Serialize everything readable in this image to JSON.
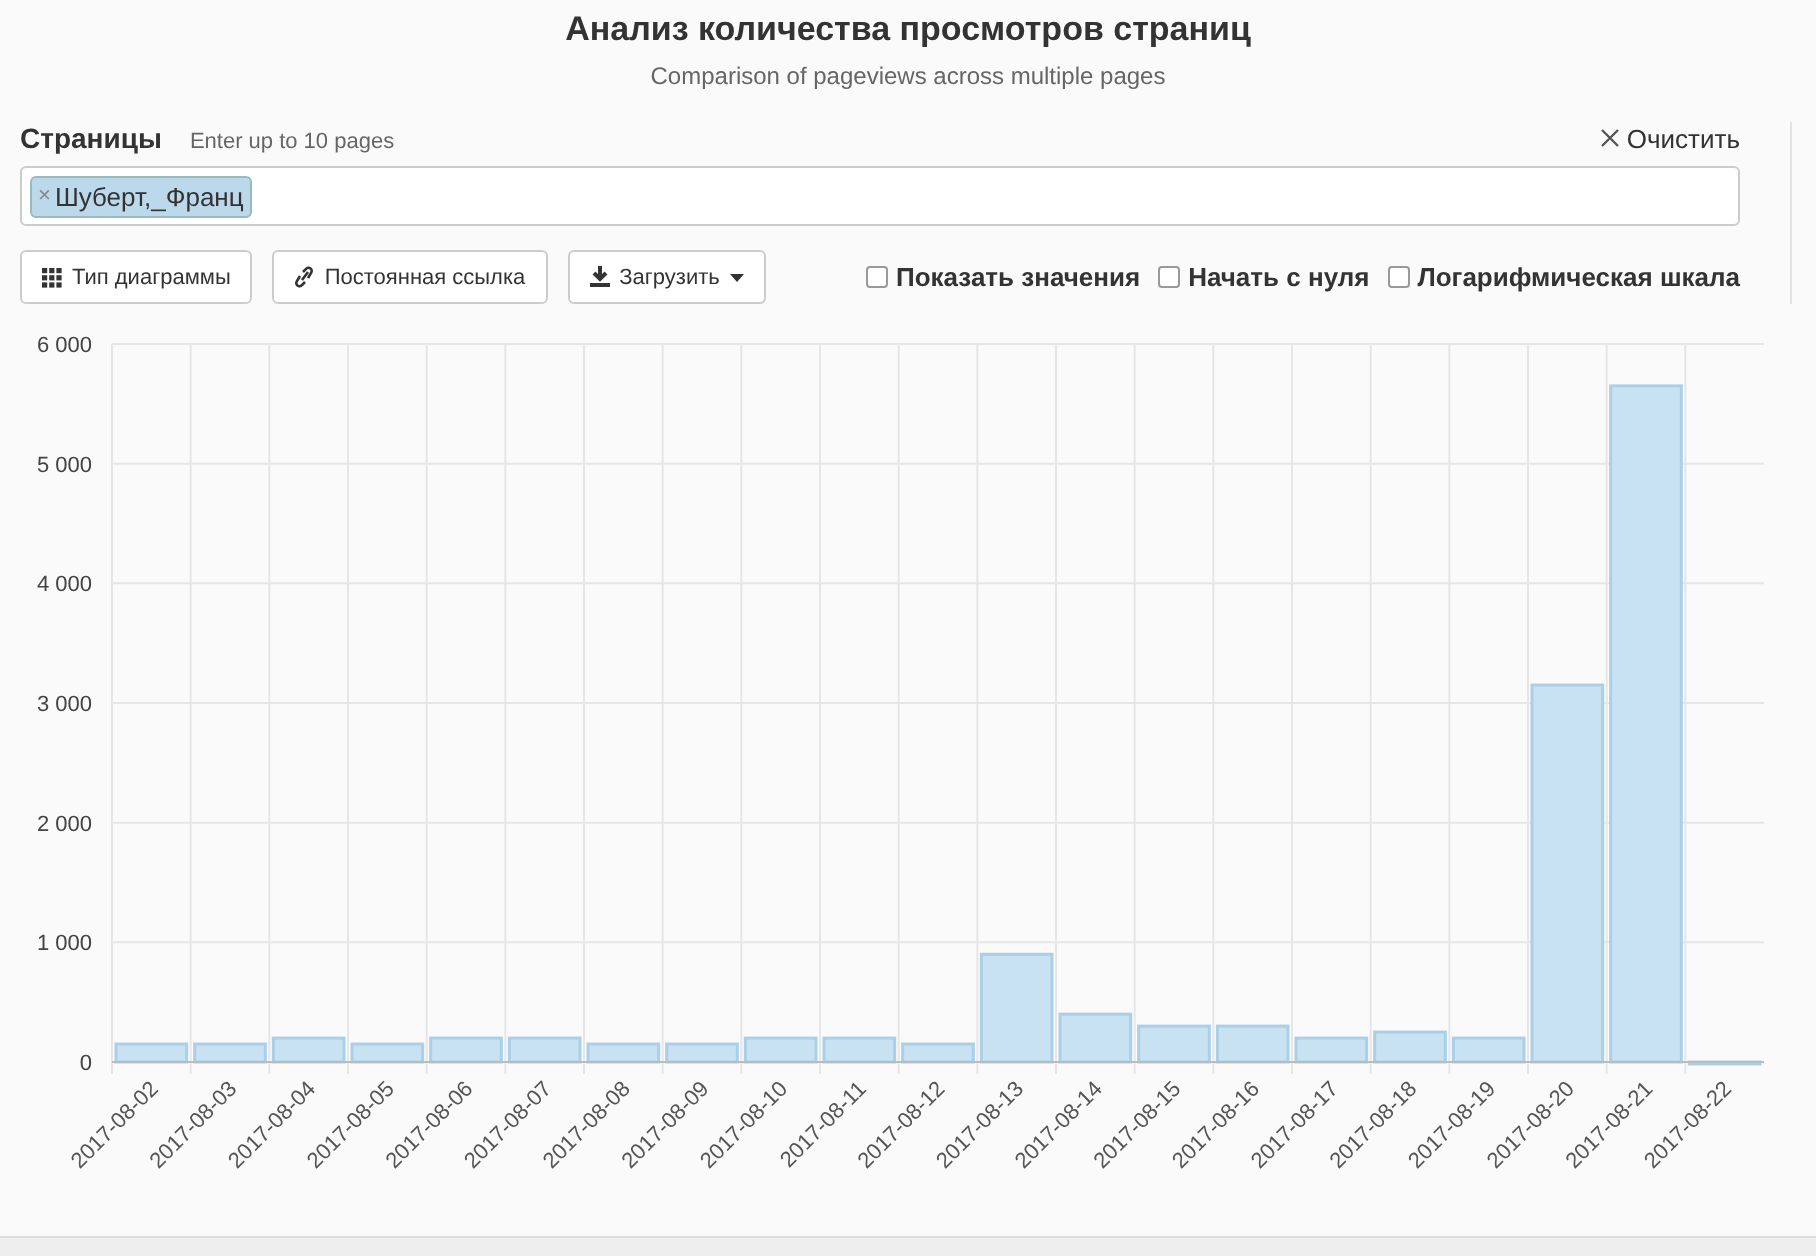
{
  "header": {
    "title": "Анализ количества просмотров страниц",
    "subtitle": "Comparison of pageviews across multiple pages"
  },
  "pages": {
    "label": "Страницы",
    "hint": "Enter up to 10 pages",
    "clear": "Очистить",
    "tags": [
      {
        "remove": "×",
        "text": "Шуберт,_Франц"
      }
    ]
  },
  "toolbar": {
    "buttons": [
      {
        "kind": "grid",
        "label": "Тип диаграммы"
      },
      {
        "kind": "link",
        "label": "Постоянная ссылка"
      },
      {
        "kind": "download",
        "label": "Загрузить"
      }
    ],
    "options": [
      {
        "label": "Показать значения",
        "checked": false
      },
      {
        "label": "Начать с нуля",
        "checked": false
      },
      {
        "label": "Логарифмическая шкала",
        "checked": false
      }
    ]
  },
  "chart_data": {
    "type": "bar",
    "categories": [
      "2017-08-02",
      "2017-08-03",
      "2017-08-04",
      "2017-08-05",
      "2017-08-06",
      "2017-08-07",
      "2017-08-08",
      "2017-08-09",
      "2017-08-10",
      "2017-08-11",
      "2017-08-12",
      "2017-08-13",
      "2017-08-14",
      "2017-08-15",
      "2017-08-16",
      "2017-08-17",
      "2017-08-18",
      "2017-08-19",
      "2017-08-20",
      "2017-08-21",
      "2017-08-22"
    ],
    "series": [
      {
        "color": "#c9e2f1",
        "values": [
          150,
          150,
          200,
          150,
          200,
          200,
          150,
          150,
          200,
          200,
          150,
          900,
          400,
          300,
          300,
          200,
          250,
          200,
          3150,
          5650,
          0
        ]
      }
    ],
    "grid": true,
    "ylim": [
      0,
      6000
    ],
    "yticks": [
      {
        "value": 0,
        "label": "0"
      },
      {
        "value": 1000,
        "label": "1 000"
      },
      {
        "value": 2000,
        "label": "2 000"
      },
      {
        "value": 3000,
        "label": "3 000"
      },
      {
        "value": 4000,
        "label": "4 000"
      },
      {
        "value": 5000,
        "label": "5 000"
      },
      {
        "value": 6000,
        "label": "6 000"
      }
    ]
  }
}
